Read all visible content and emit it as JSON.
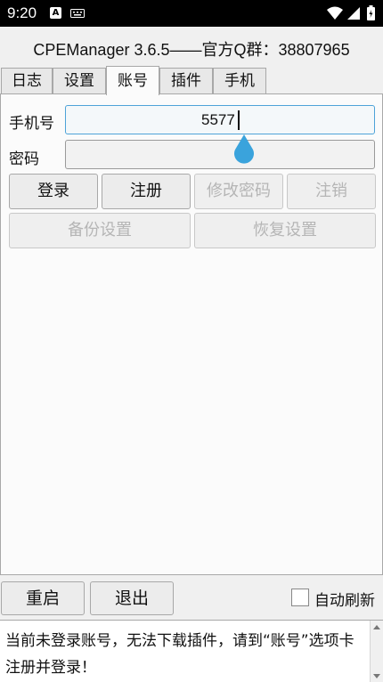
{
  "status_bar": {
    "time": "9:20",
    "notif_letter": "A"
  },
  "window": {
    "title": "CPEManager 3.6.5——官方Q群：38807965"
  },
  "tabs": [
    {
      "label": "日志",
      "active": false
    },
    {
      "label": "设置",
      "active": false
    },
    {
      "label": "账号",
      "active": true
    },
    {
      "label": "插件",
      "active": false
    },
    {
      "label": "手机",
      "active": false
    }
  ],
  "account": {
    "phone_label": "手机号",
    "phone_value": "5577",
    "password_label": "密码",
    "password_value": "",
    "login_label": "登录",
    "register_label": "注册",
    "change_password_label": "修改密码",
    "logout_label": "注销",
    "backup_label": "备份设置",
    "restore_label": "恢复设置"
  },
  "bottom_bar": {
    "restart_label": "重启",
    "exit_label": "退出",
    "auto_refresh_label": "自动刷新",
    "auto_refresh_checked": false
  },
  "log": {
    "message": "当前未登录账号，无法下载插件，请到“账号”选项卡注册并登录！"
  },
  "colors": {
    "focus_border": "#4ea3d8",
    "drop_handle": "#3aa3dc",
    "disabled_text": "#b5b5b5"
  }
}
